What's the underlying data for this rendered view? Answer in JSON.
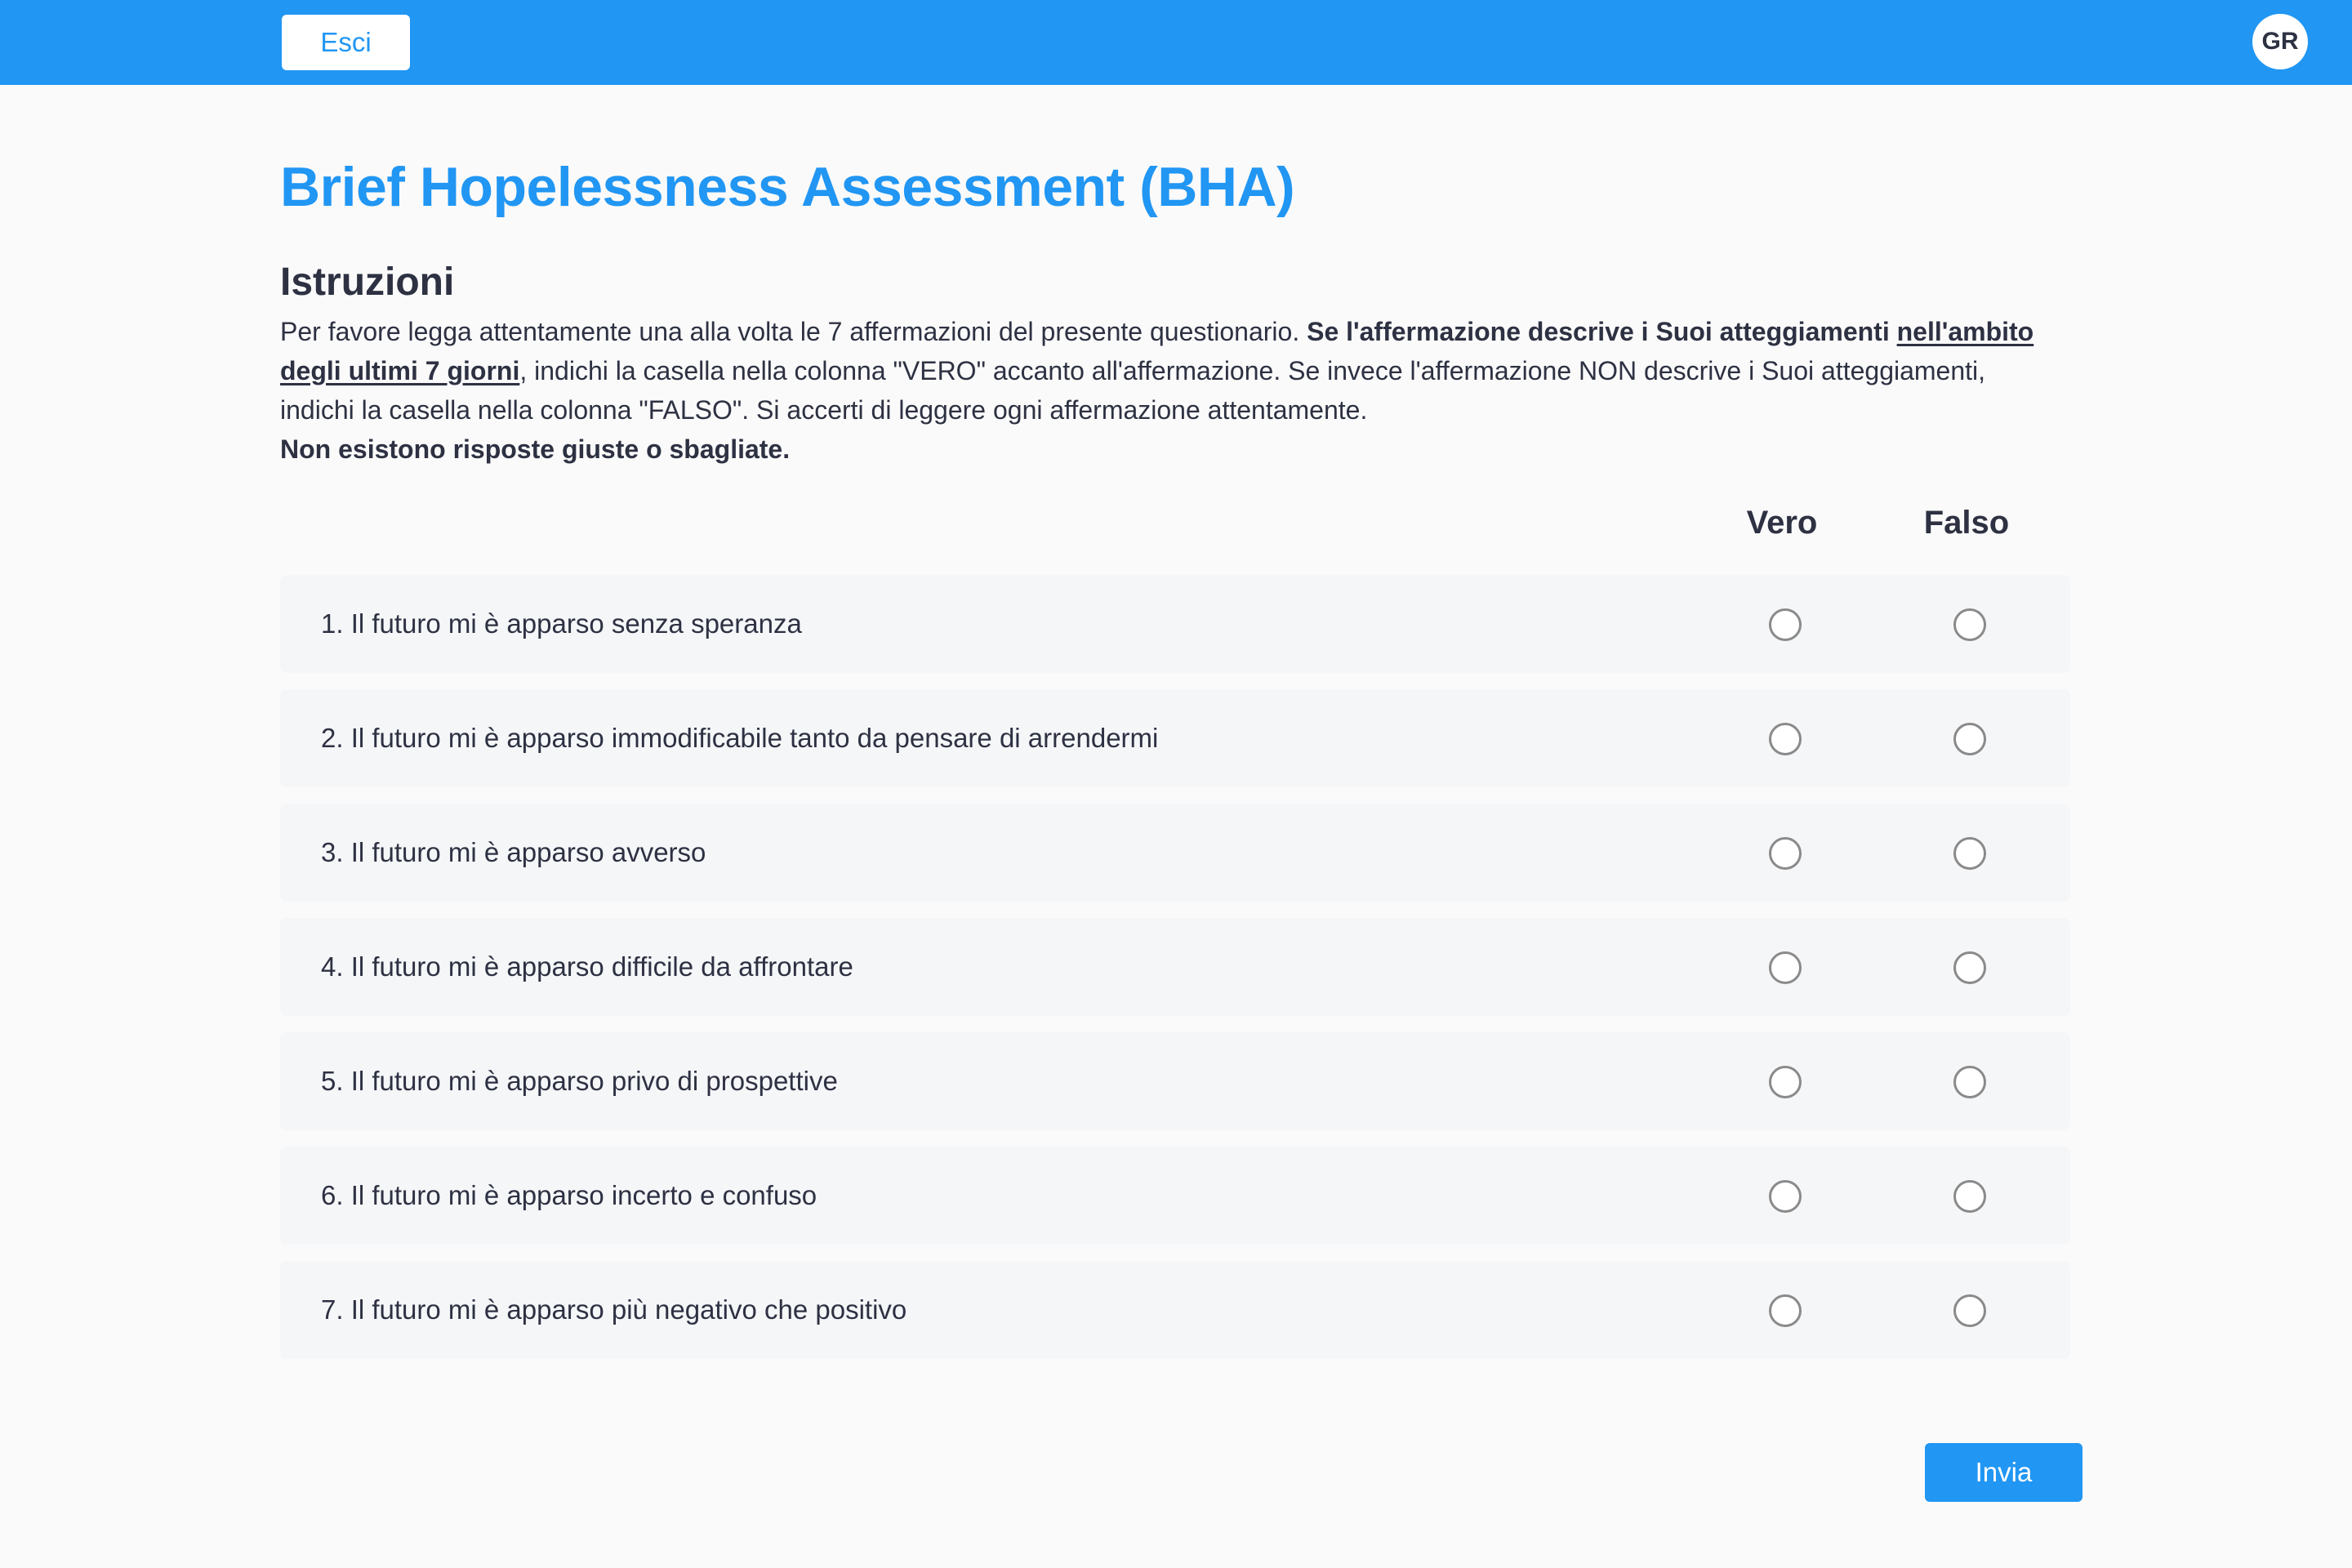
{
  "header": {
    "exit_label": "Esci",
    "avatar_initials": "GR",
    "brand_color": "#2196f3"
  },
  "page": {
    "title": "Brief Hopelessness Assessment (BHA)"
  },
  "instructions": {
    "heading": "Istruzioni",
    "text_intro": "Per favore legga attentamente una alla volta le 7 affermazioni del presente questionario. ",
    "text_bold": "Se l'affermazione descrive i Suoi atteggiamenti ",
    "text_underlined": "nell'ambito degli ultimi 7 giorni",
    "text_rest": ", indichi la casella nella colonna \"VERO\" accanto all'affermazione. Se invece l'affermazione NON descrive i Suoi atteggiamenti, indichi la casella nella colonna \"FALSO\". Si accerti di leggere ogni affermazione attentamente.",
    "note": "Non esistono risposte giuste o sbagliate."
  },
  "columns": {
    "true_label": "Vero",
    "false_label": "Falso"
  },
  "items": [
    {
      "label": "1. Il futuro mi è apparso senza speranza",
      "selected": null
    },
    {
      "label": "2. Il futuro mi è apparso immodificabile tanto da pensare di arrendermi",
      "selected": null
    },
    {
      "label": "3. Il futuro mi è apparso avverso",
      "selected": null
    },
    {
      "label": "4. Il futuro mi è apparso difficile da affrontare",
      "selected": null
    },
    {
      "label": "5. Il futuro mi è apparso privo di prospettive",
      "selected": null
    },
    {
      "label": "6. Il futuro mi è apparso incerto e confuso",
      "selected": null
    },
    {
      "label": "7. Il futuro mi è apparso più negativo che positivo",
      "selected": null
    }
  ],
  "actions": {
    "submit_label": "Invia"
  }
}
